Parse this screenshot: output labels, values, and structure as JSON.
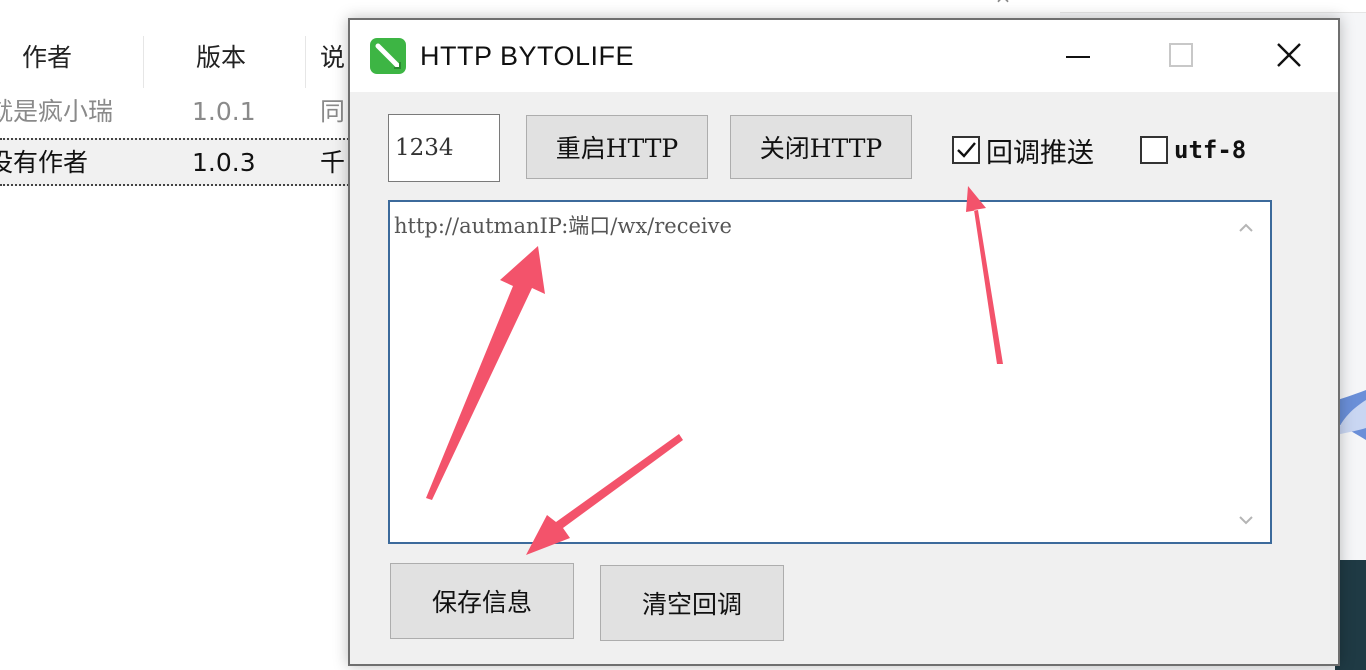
{
  "background_window": {
    "close_glyph": "×",
    "columns": [
      {
        "label": "作者"
      },
      {
        "label": "版本"
      },
      {
        "label": "说"
      }
    ],
    "rows": [
      {
        "author": "就是疯小瑞",
        "version": "1.0.1",
        "desc": "同"
      },
      {
        "author": "没有作者",
        "version": "1.0.3",
        "desc": "千"
      }
    ]
  },
  "dialog": {
    "title": "HTTP BYTOLIFE",
    "port_value": "1234",
    "restart_label": "重启HTTP",
    "close_http_label": "关闭HTTP",
    "callback_push_label": "回调推送",
    "callback_push_checked": true,
    "utf8_label": "utf-8",
    "utf8_checked": false,
    "callback_url": "http://autmanIP:端口/wx/receive",
    "save_label": "保存信息",
    "clear_label": "清空回调"
  },
  "colors": {
    "arrow": "#f3536b",
    "icon_green": "#3db544",
    "textarea_border": "#3c6a9b"
  },
  "icons": {
    "app": "green-pen-icon",
    "minimize": "minimize-icon",
    "maximize": "maximize-icon",
    "close": "close-icon",
    "check": "checkmark-icon"
  }
}
